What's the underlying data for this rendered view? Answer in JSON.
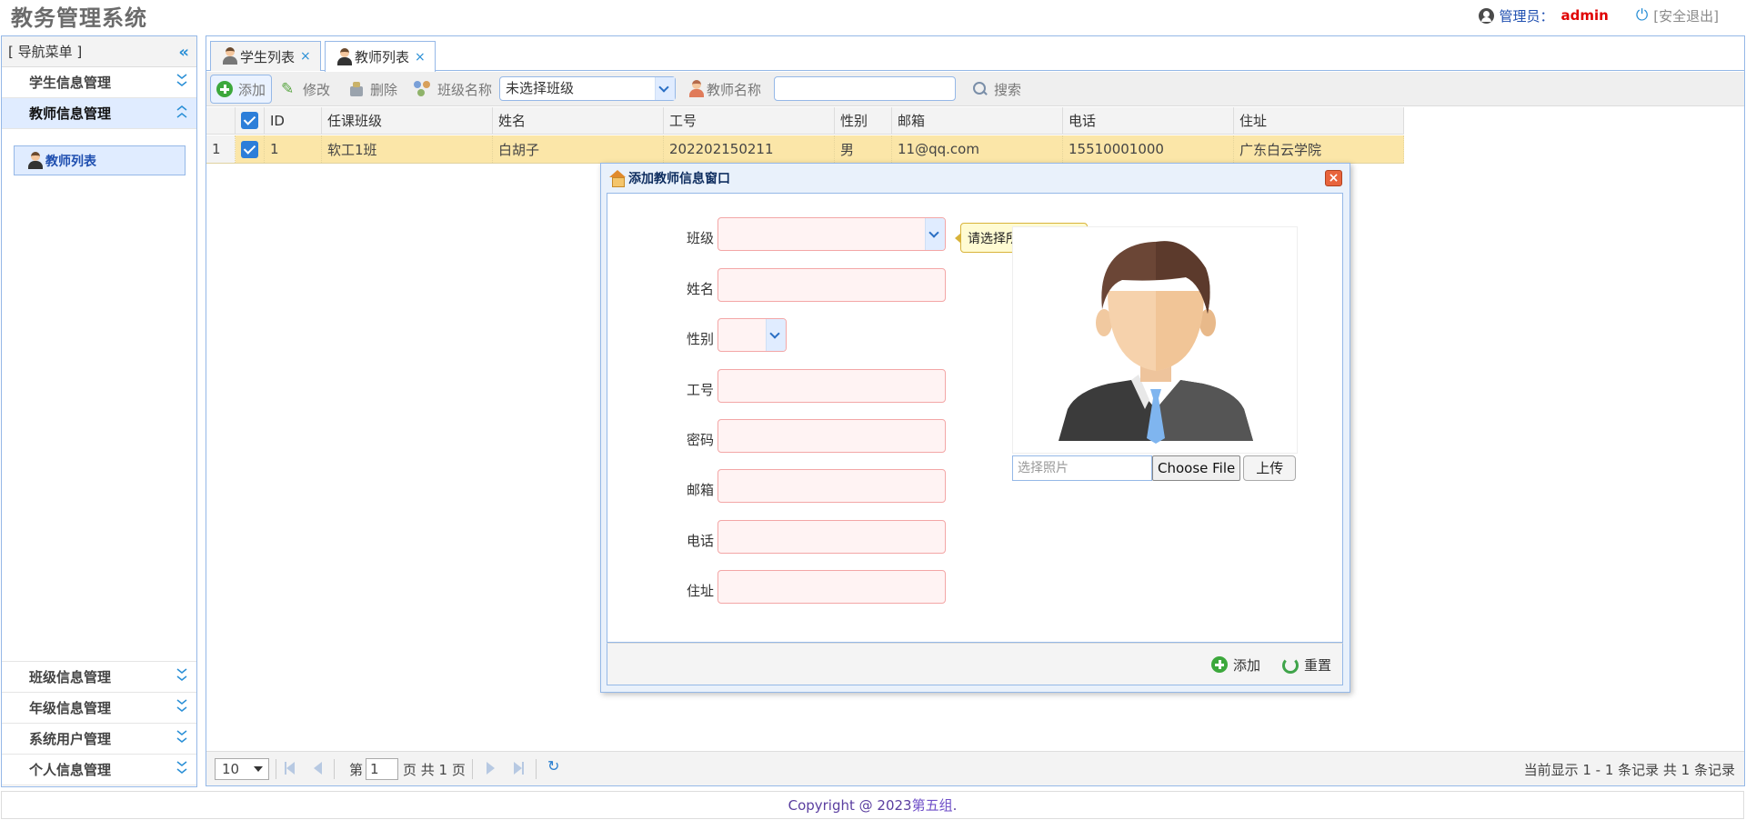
{
  "header": {
    "title": "教务管理系统",
    "admin_label": "管理员：",
    "admin_name": "admin",
    "logout": "[安全退出]"
  },
  "sidebar": {
    "title": "[ 导航菜单 ]",
    "sections": [
      {
        "label": "学生信息管理"
      },
      {
        "label": "教师信息管理"
      }
    ],
    "active_item": "教师列表",
    "bottom_sections": [
      {
        "label": "班级信息管理"
      },
      {
        "label": "年级信息管理"
      },
      {
        "label": "系统用户管理"
      },
      {
        "label": "个人信息管理"
      }
    ]
  },
  "tabs": [
    {
      "label": "学生列表",
      "close": "×"
    },
    {
      "label": "教师列表",
      "close": "×"
    }
  ],
  "toolbar": {
    "add": "添加",
    "edit": "修改",
    "delete": "删除",
    "class_label": "班级名称",
    "class_select": "未选择班级",
    "teacher_label": "教师名称",
    "teacher_input": "",
    "search": "搜索"
  },
  "grid": {
    "columns": [
      "ID",
      "任课班级",
      "姓名",
      "工号",
      "性别",
      "邮箱",
      "电话",
      "住址"
    ],
    "rows": [
      {
        "num": "1",
        "id": "1",
        "class": "软工1班",
        "name": "白胡子",
        "staff_no": "202202150211",
        "gender": "男",
        "email": "11@qq.com",
        "phone": "15510001000",
        "address": "广东白云学院"
      }
    ]
  },
  "pager": {
    "page_size": "10",
    "page_prefix": "第",
    "page_num": "1",
    "page_suffix": "页 共 1 页",
    "summary": "当前显示 1 - 1 条记录 共 1 条记录"
  },
  "dialog": {
    "title": "添加教师信息窗口",
    "close": "×",
    "fields": {
      "class": "班级",
      "name": "姓名",
      "gender": "性别",
      "staff_no": "工号",
      "password": "密码",
      "email": "邮箱",
      "phone": "电话",
      "address": "住址"
    },
    "tooltip": "请选择所属班级哟~",
    "photo_placeholder": "选择照片",
    "choose_file": "Choose File",
    "upload": "上传",
    "add_btn": "添加",
    "reset_btn": "重置"
  },
  "footer": {
    "copyright": "Copyright @ 2023 ",
    "group": "第五组",
    "end": "."
  },
  "colors": {
    "accent": "#95b8e7",
    "selected_row": "#fbe6a8",
    "admin_name": "#e00000",
    "invalid_field": "#f3a6a6"
  }
}
